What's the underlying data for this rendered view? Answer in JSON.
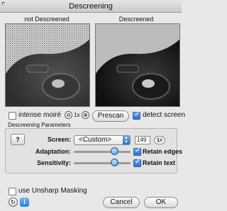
{
  "window": {
    "title": "Descreening"
  },
  "previews": {
    "left_label": "not Descreened",
    "right_label": "Descreened"
  },
  "options": {
    "intense_moire_label": "intense moiré",
    "intense_moire_checked": false,
    "zoom_label": "1x",
    "prescan_label": "Prescan",
    "detect_screen_label": "detect screen",
    "detect_screen_checked": true
  },
  "params": {
    "group_title": "Descreening Parameters",
    "help_label": "?",
    "screen_label": "Screen:",
    "screen_value": "<Custom>",
    "lpi_value": "149",
    "lpi_unit": "lpi",
    "adaptation_label": "Adaptation:",
    "adaptation_level": 0.72,
    "retain_edges_label": "Retain edges",
    "retain_edges_checked": true,
    "sensitivity_label": "Sensitivity:",
    "sensitivity_level": 0.72,
    "retain_text_label": "Retain text",
    "retain_text_checked": true
  },
  "footer": {
    "unsharp_label": "use Unsharp Masking",
    "unsharp_checked": false,
    "cancel_label": "Cancel",
    "ok_label": "OK"
  },
  "icons": [
    "zoom-out-icon",
    "zoom-in-icon",
    "reset-icon",
    "info-icon",
    "dropdown-arrow-icon"
  ],
  "colors": {
    "accent": "#2f6fcc",
    "window_bg": "#e8e8e8"
  }
}
